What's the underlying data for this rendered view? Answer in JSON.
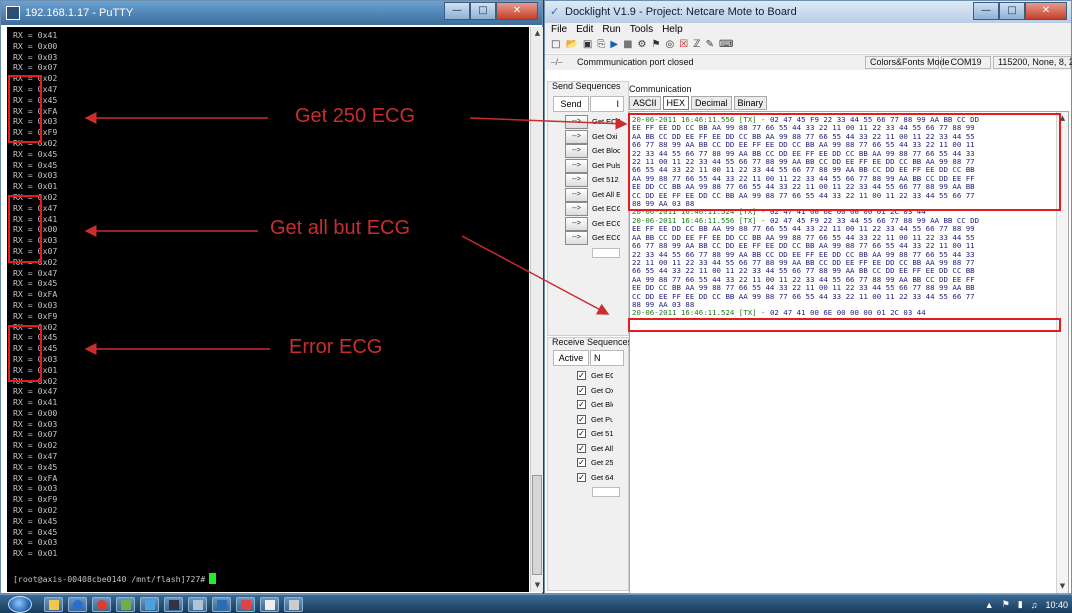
{
  "putty": {
    "title": "192.168.1.17 - PuTTY",
    "lines": [
      "RX = 0x41",
      "RX = 0x00",
      "RX = 0x03",
      "RX = 0x07",
      "RX = 0x02",
      "RX = 0x47",
      "RX = 0x45",
      "RX = 0xFA",
      "RX = 0x03",
      "RX = 0xF9",
      "RX = 0x02",
      "RX = 0x45",
      "RX = 0x45",
      "RX = 0x03",
      "RX = 0x01",
      "RX = 0x02",
      "RX = 0x47",
      "RX = 0x41",
      "RX = 0x00",
      "RX = 0x03",
      "RX = 0x07",
      "RX = 0x02",
      "RX = 0x47",
      "RX = 0x45",
      "RX = 0xFA",
      "RX = 0x03",
      "RX = 0xF9",
      "RX = 0x02",
      "RX = 0x45",
      "RX = 0x45",
      "RX = 0x03",
      "RX = 0x01",
      "RX = 0x02",
      "RX = 0x47",
      "RX = 0x41",
      "RX = 0x00",
      "RX = 0x03",
      "RX = 0x07",
      "RX = 0x02",
      "RX = 0x47",
      "RX = 0x45",
      "RX = 0xFA",
      "RX = 0x03",
      "RX = 0xF9",
      "RX = 0x02",
      "RX = 0x45",
      "RX = 0x45",
      "RX = 0x03",
      "RX = 0x01"
    ],
    "prompt": "[root@axis-00408cbe0140 /mnt/flash]727#"
  },
  "docklight": {
    "title": "Docklight V1.9 - Project: Netcare Mote to Board",
    "menu": [
      "File",
      "Edit",
      "Run",
      "Tools",
      "Help"
    ],
    "toolbar_icons": [
      "new-icon",
      "open-icon",
      "save-icon",
      "print-icon",
      "run-icon",
      "stop-icon",
      "settings-icon",
      "flag-icon",
      "find-icon",
      "clear-icon",
      "snooze-icon",
      "script-icon",
      "keyboard-icon"
    ],
    "status": {
      "port_status": "Commmunication port closed",
      "mode": "Colors&Fonts Mode",
      "port": "COM19",
      "settings": "115200, None, 8, 2"
    },
    "send_sequences": {
      "title": "Send Sequences",
      "header_send": "Send",
      "header_name": "I",
      "button_label": "-->",
      "items": [
        "Get ECG",
        "Get Oxi",
        "Get Blood",
        "Get Puls",
        "Get 512",
        "Get All E",
        "Get ECG",
        "Get ECG",
        "Get ECG"
      ]
    },
    "receive_sequences": {
      "title": "Receive Sequences",
      "header_active": "Active",
      "header_name": "N",
      "items": [
        "Get ECG",
        "Get Oxi",
        "Get Blood",
        "Get Puls",
        "Get 512",
        "Get All E",
        "Get 250",
        "Get 64 E"
      ]
    },
    "communication": {
      "title": "Communication",
      "tabs": [
        "ASCII",
        "HEX",
        "Decimal",
        "Binary"
      ],
      "active_tab": "HEX",
      "blocks": [
        {
          "timestamp": "20-06-2011 16:46:11.556 [TX] -",
          "first": " 02 47 45 F9 22 33 44 55 66 77 88 99 AA BB CC DD",
          "lines": [
            "EE FF EE DD CC BB AA 99 88 77 66 55 44 33 22 11 00 11 22 33 44 55 66 77 88 99",
            "AA BB CC DD EE FF EE DD CC BB AA 99 88 77 66 55 44 33 22 11 00 11 22 33 44 55",
            "66 77 88 99 AA BB CC DD EE FF EE DD CC BB AA 99 88 77 66 55 44 33 22 11 00 11",
            "22 33 44 55 66 77 88 99 AA BB CC DD EE FF EE DD CC BB AA 99 88 77 66 55 44 33",
            "22 11 00 11 22 33 44 55 66 77 88 99 AA BB CC DD EE FF EE DD CC BB AA 99 88 77",
            "66 55 44 33 22 11 00 11 22 33 44 55 66 77 88 99 AA BB CC DD EE FF EE DD CC BB",
            "AA 99 88 77 66 55 44 33 22 11 00 11 22 33 44 55 66 77 88 99 AA BB CC DD EE FF",
            "EE DD CC BB AA 99 88 77 66 55 44 33 22 11 00 11 22 33 44 55 66 77 88 99 AA BB",
            "CC DD EE FF EE DD CC BB AA 99 88 77 66 55 44 33 22 11 00 11 22 33 44 55 66 77",
            "88 99 AA 03 88"
          ]
        },
        {
          "timestamp": "20-06-2011 16:46:11.524 [TX] -",
          "first": " 02 47 41 00 6E 00 00 00 01 2C 03 44",
          "lines": []
        },
        {
          "timestamp": "20-06-2011 16:46:11.556 [TX] -",
          "first": " 02 47 45 F9 22 33 44 55 66 77 88 99 AA BB CC DD",
          "lines": [
            "EE FF EE DD CC BB AA 99 88 77 66 55 44 33 22 11 00 11 22 33 44 55 66 77 88 99",
            "AA BB CC DD EE FF EE DD CC BB AA 99 88 77 66 55 44 33 22 11 00 11 22 33 44 55",
            "66 77 88 99 AA BB CC DD EE FF EE DD CC BB AA 99 88 77 66 55 44 33 22 11 00 11",
            "22 33 44 55 66 77 88 99 AA BB CC DD EE FF EE DD CC BB AA 99 88 77 66 55 44 33",
            "22 11 00 11 22 33 44 55 66 77 88 99 AA BB CC DD EE FF EE DD CC BB AA 99 88 77",
            "66 55 44 33 22 11 00 11 22 33 44 55 66 77 88 99 AA BB CC DD EE FF EE DD CC BB",
            "AA 99 88 77 66 55 44 33 22 11 00 11 22 33 44 55 66 77 88 99 AA BB CC DD EE FF",
            "EE DD CC BB AA 99 88 77 66 55 44 33 22 11 00 11 22 33 44 55 66 77 88 99 AA BB",
            "CC DD EE FF EE DD CC BB AA 99 88 77 66 55 44 33 22 11 00 11 22 33 44 55 66 77",
            "88 99 AA 03 88"
          ]
        },
        {
          "timestamp": "20-06-2011 16:46:11.524 [TX] -",
          "first": " 02 47 41 00 6E 00 00 00 01 2C 03 44",
          "lines": []
        }
      ]
    }
  },
  "annotations": {
    "get250": "Get 250 ECG",
    "getall": "Get all but ECG",
    "error": "Error ECG",
    "color": "#c92d2d"
  },
  "taskbar": {
    "clock": "10:40",
    "app_icons": [
      "explorer-icon",
      "media-icon",
      "chrome-icon",
      "paint-icon",
      "network-icon",
      "putty-icon",
      "tool-icon",
      "docklight-icon",
      "app-icon",
      "app2-icon",
      "app3-icon"
    ]
  }
}
